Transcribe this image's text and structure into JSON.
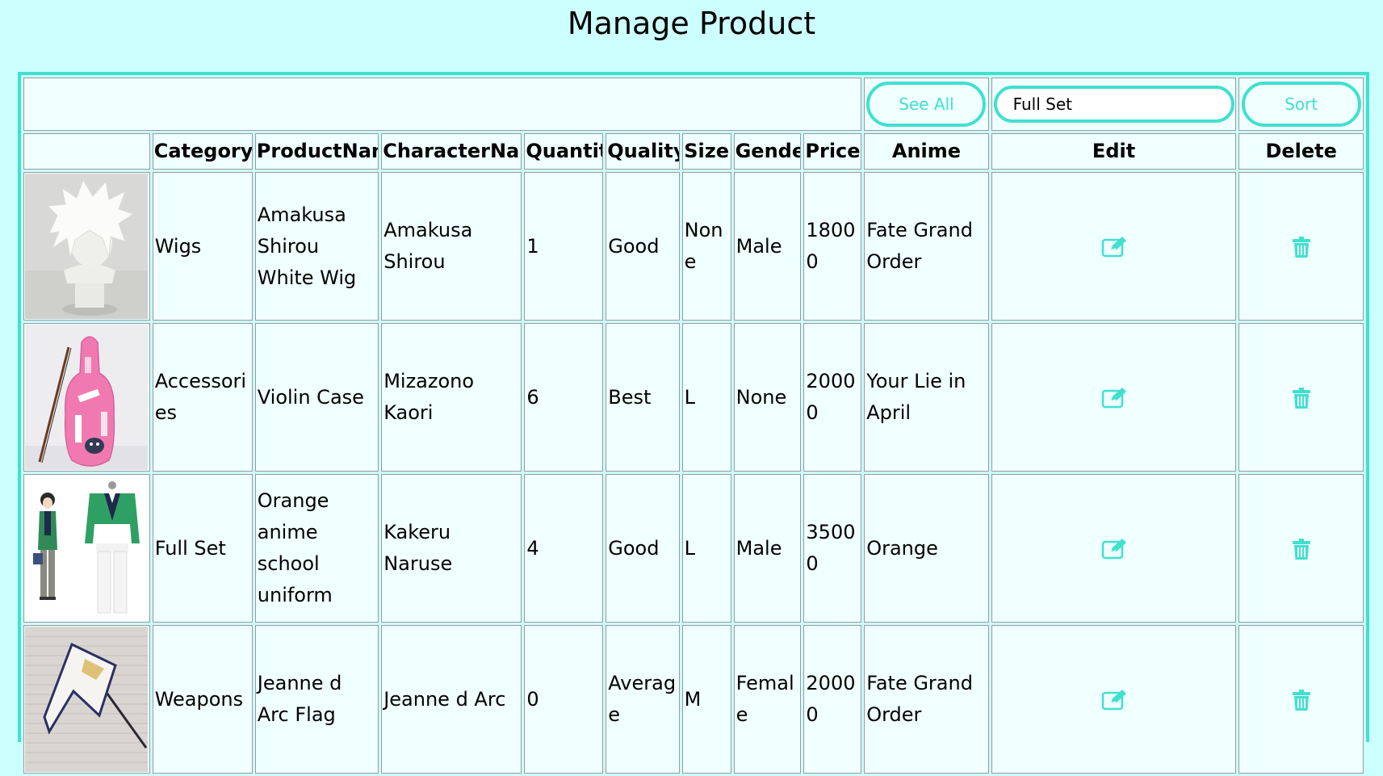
{
  "page": {
    "title": "Manage Product"
  },
  "toolbar": {
    "see_all_label": "See All",
    "search_value": "Full Set",
    "sort_label": "Sort"
  },
  "columns": [
    "",
    "Category",
    "ProductName",
    "CharacterName",
    "Quantity",
    "Quality",
    "Size",
    "Gender",
    "Price",
    "Anime",
    "Edit",
    "Delete"
  ],
  "rows": [
    {
      "image": "white-wig-on-mannequin",
      "category": "Wigs",
      "product_name": "Amakusa Shirou White Wig",
      "character_name": "Amakusa Shirou",
      "quantity": "1",
      "quality": "Good",
      "size": "None",
      "gender": "Male",
      "price": "18000",
      "anime": "Fate Grand Order"
    },
    {
      "image": "pink-violin-case",
      "category": "Accessories",
      "product_name": "Violin Case",
      "character_name": "Mizazono Kaori",
      "quantity": "6",
      "quality": "Best",
      "size": "L",
      "gender": "None",
      "price": "20000",
      "anime": "Your Lie in April"
    },
    {
      "image": "green-school-uniform",
      "category": "Full Set",
      "product_name": "Orange anime school uniform",
      "character_name": "Kakeru Naruse",
      "quantity": "4",
      "quality": "Good",
      "size": "L",
      "gender": "Male",
      "price": "35000",
      "anime": "Orange"
    },
    {
      "image": "jeanne-flag-on-brick-wall",
      "category": "Weapons",
      "product_name": "Jeanne d Arc Flag",
      "character_name": "Jeanne d Arc",
      "quantity": "0",
      "quality": "Average",
      "size": "M",
      "gender": "Female",
      "price": "20000",
      "anime": "Fate Grand Order"
    }
  ],
  "icons": {
    "edit": "edit-icon",
    "delete": "trash-icon"
  },
  "colors": {
    "background": "#ccffff",
    "accent": "#40e0d0",
    "cell_background": "#f0ffff"
  }
}
